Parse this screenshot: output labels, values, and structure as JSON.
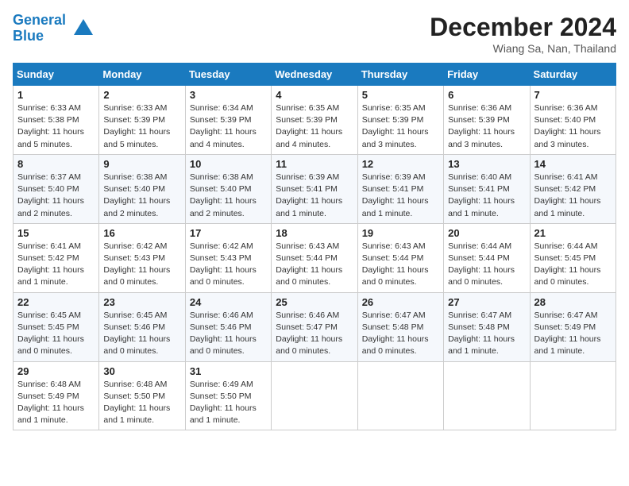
{
  "header": {
    "logo_line1": "General",
    "logo_line2": "Blue",
    "month": "December 2024",
    "location": "Wiang Sa, Nan, Thailand"
  },
  "weekdays": [
    "Sunday",
    "Monday",
    "Tuesday",
    "Wednesday",
    "Thursday",
    "Friday",
    "Saturday"
  ],
  "weeks": [
    [
      {
        "day": "1",
        "info": "Sunrise: 6:33 AM\nSunset: 5:38 PM\nDaylight: 11 hours\nand 5 minutes."
      },
      {
        "day": "2",
        "info": "Sunrise: 6:33 AM\nSunset: 5:39 PM\nDaylight: 11 hours\nand 5 minutes."
      },
      {
        "day": "3",
        "info": "Sunrise: 6:34 AM\nSunset: 5:39 PM\nDaylight: 11 hours\nand 4 minutes."
      },
      {
        "day": "4",
        "info": "Sunrise: 6:35 AM\nSunset: 5:39 PM\nDaylight: 11 hours\nand 4 minutes."
      },
      {
        "day": "5",
        "info": "Sunrise: 6:35 AM\nSunset: 5:39 PM\nDaylight: 11 hours\nand 3 minutes."
      },
      {
        "day": "6",
        "info": "Sunrise: 6:36 AM\nSunset: 5:39 PM\nDaylight: 11 hours\nand 3 minutes."
      },
      {
        "day": "7",
        "info": "Sunrise: 6:36 AM\nSunset: 5:40 PM\nDaylight: 11 hours\nand 3 minutes."
      }
    ],
    [
      {
        "day": "8",
        "info": "Sunrise: 6:37 AM\nSunset: 5:40 PM\nDaylight: 11 hours\nand 2 minutes."
      },
      {
        "day": "9",
        "info": "Sunrise: 6:38 AM\nSunset: 5:40 PM\nDaylight: 11 hours\nand 2 minutes."
      },
      {
        "day": "10",
        "info": "Sunrise: 6:38 AM\nSunset: 5:40 PM\nDaylight: 11 hours\nand 2 minutes."
      },
      {
        "day": "11",
        "info": "Sunrise: 6:39 AM\nSunset: 5:41 PM\nDaylight: 11 hours\nand 1 minute."
      },
      {
        "day": "12",
        "info": "Sunrise: 6:39 AM\nSunset: 5:41 PM\nDaylight: 11 hours\nand 1 minute."
      },
      {
        "day": "13",
        "info": "Sunrise: 6:40 AM\nSunset: 5:41 PM\nDaylight: 11 hours\nand 1 minute."
      },
      {
        "day": "14",
        "info": "Sunrise: 6:41 AM\nSunset: 5:42 PM\nDaylight: 11 hours\nand 1 minute."
      }
    ],
    [
      {
        "day": "15",
        "info": "Sunrise: 6:41 AM\nSunset: 5:42 PM\nDaylight: 11 hours\nand 1 minute."
      },
      {
        "day": "16",
        "info": "Sunrise: 6:42 AM\nSunset: 5:43 PM\nDaylight: 11 hours\nand 0 minutes."
      },
      {
        "day": "17",
        "info": "Sunrise: 6:42 AM\nSunset: 5:43 PM\nDaylight: 11 hours\nand 0 minutes."
      },
      {
        "day": "18",
        "info": "Sunrise: 6:43 AM\nSunset: 5:44 PM\nDaylight: 11 hours\nand 0 minutes."
      },
      {
        "day": "19",
        "info": "Sunrise: 6:43 AM\nSunset: 5:44 PM\nDaylight: 11 hours\nand 0 minutes."
      },
      {
        "day": "20",
        "info": "Sunrise: 6:44 AM\nSunset: 5:44 PM\nDaylight: 11 hours\nand 0 minutes."
      },
      {
        "day": "21",
        "info": "Sunrise: 6:44 AM\nSunset: 5:45 PM\nDaylight: 11 hours\nand 0 minutes."
      }
    ],
    [
      {
        "day": "22",
        "info": "Sunrise: 6:45 AM\nSunset: 5:45 PM\nDaylight: 11 hours\nand 0 minutes."
      },
      {
        "day": "23",
        "info": "Sunrise: 6:45 AM\nSunset: 5:46 PM\nDaylight: 11 hours\nand 0 minutes."
      },
      {
        "day": "24",
        "info": "Sunrise: 6:46 AM\nSunset: 5:46 PM\nDaylight: 11 hours\nand 0 minutes."
      },
      {
        "day": "25",
        "info": "Sunrise: 6:46 AM\nSunset: 5:47 PM\nDaylight: 11 hours\nand 0 minutes."
      },
      {
        "day": "26",
        "info": "Sunrise: 6:47 AM\nSunset: 5:48 PM\nDaylight: 11 hours\nand 0 minutes."
      },
      {
        "day": "27",
        "info": "Sunrise: 6:47 AM\nSunset: 5:48 PM\nDaylight: 11 hours\nand 1 minute."
      },
      {
        "day": "28",
        "info": "Sunrise: 6:47 AM\nSunset: 5:49 PM\nDaylight: 11 hours\nand 1 minute."
      }
    ],
    [
      {
        "day": "29",
        "info": "Sunrise: 6:48 AM\nSunset: 5:49 PM\nDaylight: 11 hours\nand 1 minute."
      },
      {
        "day": "30",
        "info": "Sunrise: 6:48 AM\nSunset: 5:50 PM\nDaylight: 11 hours\nand 1 minute."
      },
      {
        "day": "31",
        "info": "Sunrise: 6:49 AM\nSunset: 5:50 PM\nDaylight: 11 hours\nand 1 minute."
      },
      null,
      null,
      null,
      null
    ]
  ]
}
